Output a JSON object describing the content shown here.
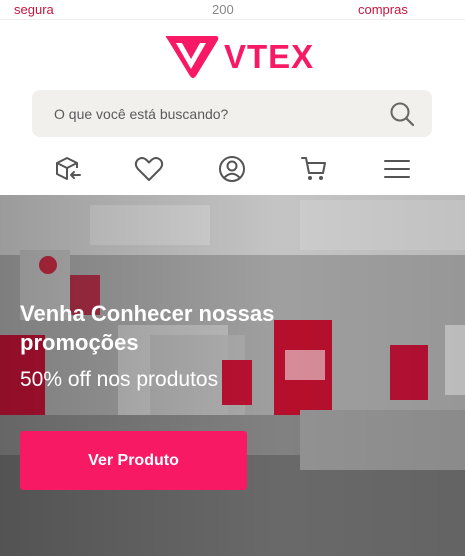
{
  "topbar": {
    "left": "segura",
    "middle": "200",
    "right": "compras"
  },
  "brand": {
    "name": "VTEX",
    "color": "#f71963"
  },
  "search": {
    "placeholder": "O que você está buscando?",
    "icon": "search-icon"
  },
  "icons": [
    "return-box-icon",
    "heart-icon",
    "user-icon",
    "cart-icon",
    "menu-icon"
  ],
  "hero": {
    "title": "Venha Conhecer nossas promoções",
    "subtitle": "50% off nos produtos",
    "cta_label": "Ver Produto",
    "cta_color": "#f71963"
  }
}
